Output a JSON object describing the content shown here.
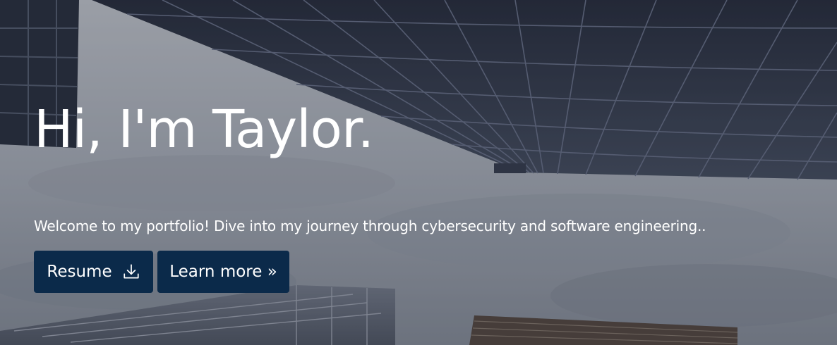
{
  "hero": {
    "title": "Hi, I'm Taylor.",
    "subtitle": "Welcome to my portfolio! Dive into my journey through cybersecurity and software engineering..",
    "background": "upward-view-of-glass-skyscrapers-against-cloudy-sky",
    "buttons": {
      "resume_label": "Resume",
      "resume_icon": "download-icon",
      "learn_more_label": "Learn more »"
    },
    "colors": {
      "button_background": "#0b2a4a",
      "text": "#ffffff"
    }
  }
}
